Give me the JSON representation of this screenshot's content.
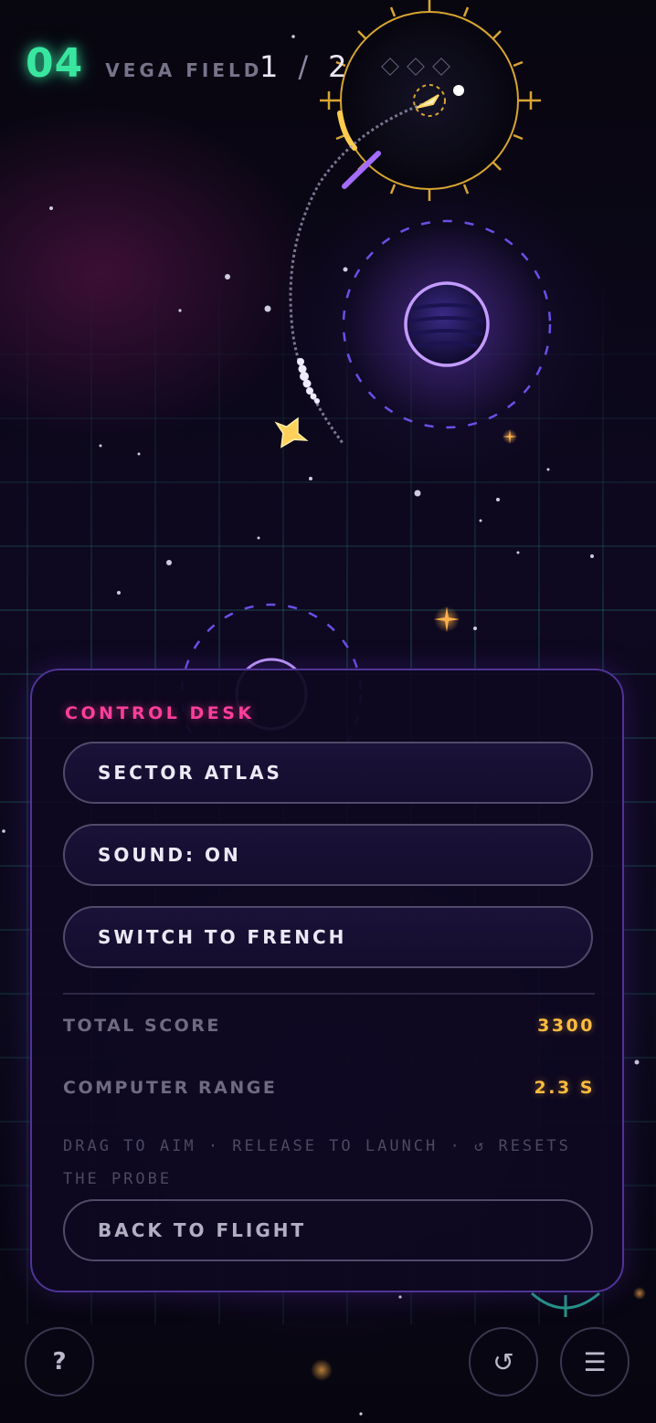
{
  "hud": {
    "level": "04",
    "field_name": "VEGA FIELD",
    "progress_current": "1",
    "progress_separator": "/",
    "progress_total": "2",
    "gem_icons": [
      "diamond-outline-icon",
      "diamond-outline-icon",
      "diamond-outline-icon"
    ]
  },
  "panel": {
    "title": "CONTROL DESK",
    "buttons": {
      "sector_atlas": "SECTOR ATLAS",
      "sound": "SOUND: ON",
      "language": "SWITCH TO FRENCH",
      "back": "BACK TO FLIGHT"
    },
    "stats": {
      "total_score_label": "TOTAL SCORE",
      "total_score_value": "3300",
      "computer_range_label": "COMPUTER RANGE",
      "computer_range_value": "2.3 S"
    },
    "hint": "DRAG TO AIM · RELEASE TO LAUNCH · ↺ RESETS THE PROBE"
  },
  "controls": {
    "help_label": "?",
    "reset_icon": "↺",
    "menu_icon": "☰"
  },
  "colors": {
    "level_accent": "#39e6a0",
    "panel_title": "#ff3e9b",
    "stat_value": "#ffbb3d",
    "panel_border": "#4f3496",
    "planet_glow": "#b07bff",
    "target_ring": "#d9a531"
  }
}
